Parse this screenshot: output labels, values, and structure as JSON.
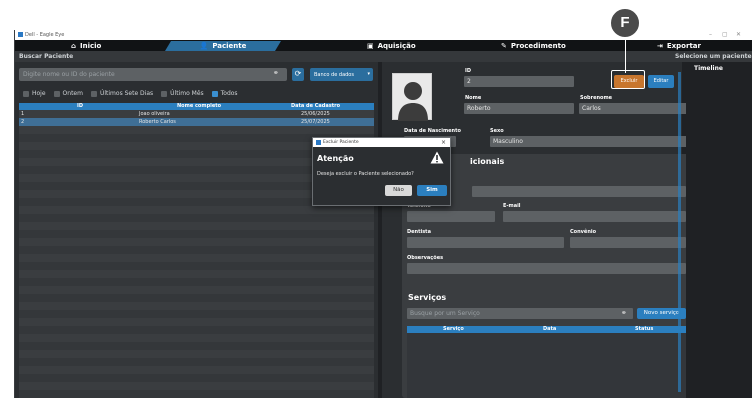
{
  "window": {
    "title": "Dell - Eagle Eye",
    "controls": [
      "–",
      "▢",
      "✕"
    ]
  },
  "nav": {
    "items": [
      {
        "label": "Inicio",
        "icon": "home-icon"
      },
      {
        "label": "Paciente",
        "icon": "user-icon"
      },
      {
        "label": "Aquisição",
        "icon": "image-icon"
      },
      {
        "label": "Procedimento",
        "icon": "edit-icon"
      },
      {
        "label": "Exportar",
        "icon": "export-icon"
      }
    ],
    "active": "Paciente"
  },
  "subbar": {
    "left": "Buscar Paciente",
    "right": "Selecione um paciente"
  },
  "search": {
    "placeholder": "Digite nome ou ID do paciente",
    "database_label": "Banco de dados",
    "filters": [
      {
        "label": "Hoje",
        "checked": false
      },
      {
        "label": "Ontem",
        "checked": false
      },
      {
        "label": "Últimos Sete Dias",
        "checked": false
      },
      {
        "label": "Último Mês",
        "checked": false
      },
      {
        "label": "Todos",
        "checked": true
      }
    ]
  },
  "patients_table": {
    "columns": [
      "ID",
      "Nome completo",
      "Data de Cadastro"
    ],
    "rows": [
      {
        "id": "1",
        "name": "Joao oliveira",
        "date": "25/06/2025",
        "selected": false
      },
      {
        "id": "2",
        "name": "Roberto Carlos",
        "date": "25/07/2025",
        "selected": true
      }
    ]
  },
  "patient": {
    "id_label": "ID",
    "id_value": "2",
    "nome_label": "Nome",
    "nome_value": "Roberto",
    "sobrenome_label": "Sobrenome",
    "sobrenome_value": "Carlos",
    "nascimento_label": "Data de Nascimento",
    "nascimento_value": "",
    "sexo_label": "Sexo",
    "sexo_value": "Masculino",
    "excluir_label": "Excluir",
    "editar_label": "Editar"
  },
  "info_adicionais": {
    "title_visible": "icionais",
    "telefone_label": "Telefone",
    "email_label": "E-mail",
    "dentista_label": "Dentista",
    "convenio_label": "Convênio",
    "observacoes_label": "Observações"
  },
  "servicos": {
    "title": "Serviços",
    "search_placeholder": "Busque por um Serviço",
    "novo_label": "Novo serviço",
    "columns": [
      "Serviço",
      "Data",
      "Status"
    ]
  },
  "timeline": {
    "title": "Timeline"
  },
  "modal": {
    "window_title": "Excluir Paciente",
    "title": "Atenção",
    "message": "Deseja excluir o Paciente selecionado?",
    "no_label": "Não",
    "yes_label": "Sim"
  },
  "annotation": {
    "letter": "F"
  },
  "colors": {
    "accent": "#2b7fbf",
    "danger": "#c8762e",
    "bg": "#2b2e31"
  }
}
